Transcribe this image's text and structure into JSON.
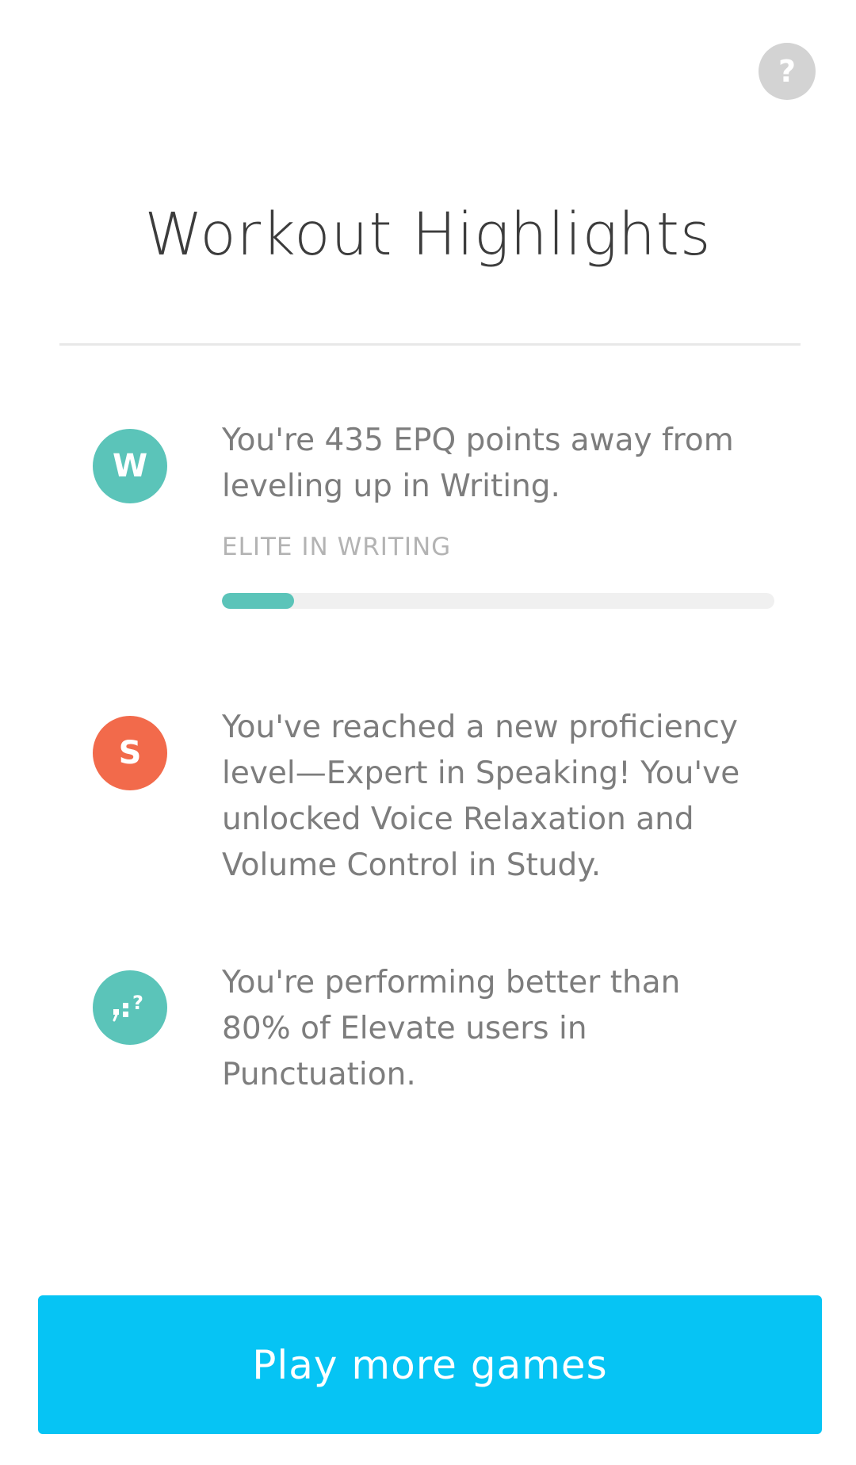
{
  "header": {
    "help_icon": "question-mark-icon",
    "help_label": "?",
    "title": "Workout Highlights"
  },
  "highlights": [
    {
      "badge_label": "W",
      "badge_color": "#5bc4b9",
      "text": "You're 435 EPQ points away from leveling up in Writing.",
      "level_label": "ELITE IN WRITING",
      "progress_fraction": 0.13
    },
    {
      "badge_label": "S",
      "badge_color": "#f26a4b",
      "text": "You've reached a new proficiency level—Expert in Speaking! You've unlocked Voice Relaxation and Volume Control in Study."
    },
    {
      "badge_icon": "punctuation-icon",
      "badge_color": "#5bc4b9",
      "text": "You're performing better than 80% of Elevate users in Punctuation."
    }
  ],
  "cta": {
    "label": "Play more games",
    "color": "#06c4f4"
  }
}
